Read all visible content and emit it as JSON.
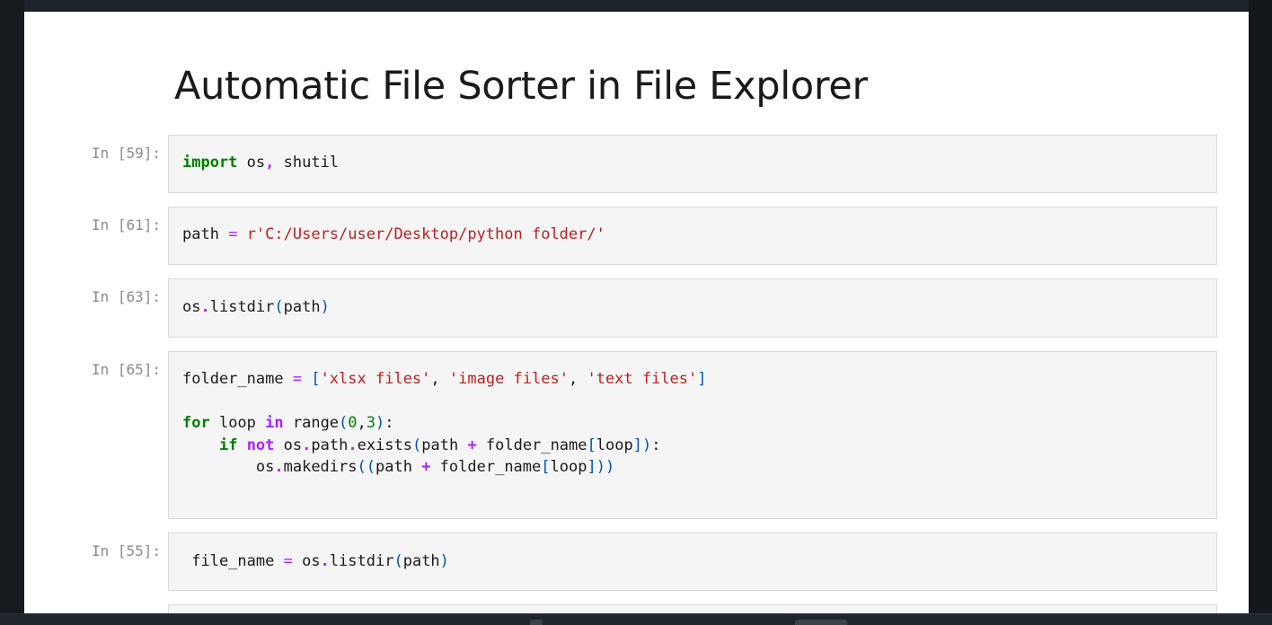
{
  "notebook": {
    "title": "Automatic File Sorter in File Explorer",
    "cells": [
      {
        "prompt": "In [59]:",
        "lines": [
          "import os, shutil"
        ]
      },
      {
        "prompt": "In [61]:",
        "lines": [
          "path = r'C:/Users/user/Desktop/python folder/'"
        ]
      },
      {
        "prompt": "In [63]:",
        "lines": [
          "os.listdir(path)"
        ]
      },
      {
        "prompt": "In [65]:",
        "lines": [
          "folder_name = ['xlsx files', 'image files', 'text files']",
          "",
          "for loop in range(0,3):",
          "    if not os.path.exists(path + folder_name[loop]):",
          "        os.makedirs((path + folder_name[loop]))"
        ]
      },
      {
        "prompt": "In [55]:",
        "lines": [
          " file_name = os.listdir(path)"
        ]
      }
    ]
  },
  "colors": {
    "keyword": "#008000",
    "operator": "#aa22ff",
    "string": "#ba2121",
    "bracket": "#0055aa",
    "prompt": "#8a8a8a",
    "cell_background": "#f5f5f5"
  }
}
